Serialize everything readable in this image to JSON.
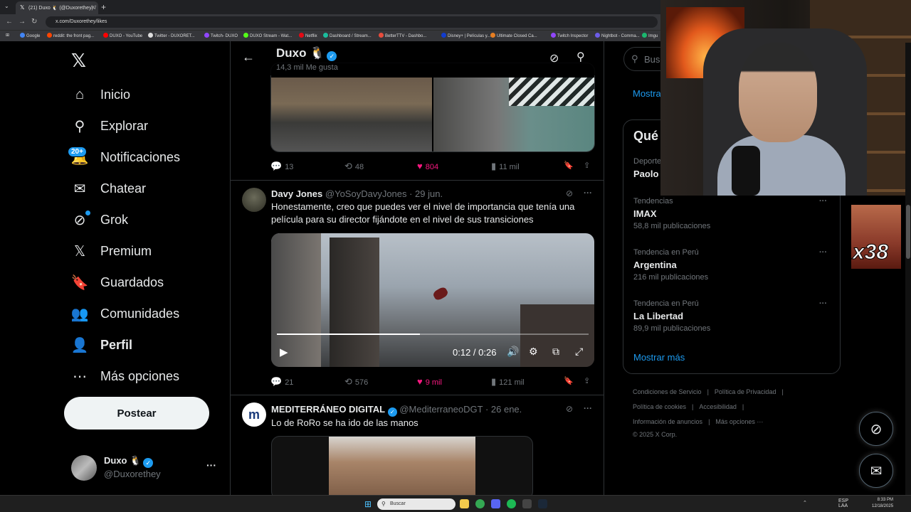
{
  "browser": {
    "tab_title": "(21) Duxo 🐧 (@Duxorethey) /",
    "url": "x.com/Duxorethey/likes",
    "bookmarks": [
      "Google",
      "reddit: the front pag...",
      "DUXO - YouTube",
      "Twitter - DUXORET...",
      "Twitch- DUXO",
      "DUXO Stream - Wat...",
      "Netflix",
      "Dashboard / Stream...",
      "BetterTTV - Dashbo...",
      "Disney+ | Películas y...",
      "Ultimate Closed Ca...",
      "Twitch Inspector",
      "Nightbot - Comma...",
      "Imgu"
    ],
    "bookmark_colors": [
      "#4285f4",
      "#ff4500",
      "#ff0000",
      "#dddddd",
      "#9146ff",
      "#53fc18",
      "#e50914",
      "#1abc9c",
      "#e74c3c",
      "#113ccf",
      "#e67e22",
      "#9146ff",
      "#6c5ce7",
      "#1bb76e"
    ]
  },
  "sidebar": {
    "logo": "𝕏",
    "notif_badge": "20+",
    "items": [
      {
        "label": "Inicio",
        "icon": "home-icon",
        "glyph": "⌂"
      },
      {
        "label": "Explorar",
        "icon": "search-icon",
        "glyph": "⚲"
      },
      {
        "label": "Notificaciones",
        "icon": "bell-icon",
        "glyph": "🔔"
      },
      {
        "label": "Chatear",
        "icon": "mail-icon",
        "glyph": "✉"
      },
      {
        "label": "Grok",
        "icon": "grok-icon",
        "glyph": "⊘"
      },
      {
        "label": "Premium",
        "icon": "x-icon",
        "glyph": "𝕏"
      },
      {
        "label": "Guardados",
        "icon": "bookmark-icon",
        "glyph": "🔖"
      },
      {
        "label": "Comunidades",
        "icon": "communities-icon",
        "glyph": "👥"
      },
      {
        "label": "Perfil",
        "icon": "profile-icon",
        "glyph": "👤"
      },
      {
        "label": "Más opciones",
        "icon": "more-circle-icon",
        "glyph": "⋯"
      }
    ],
    "post_button": "Postear",
    "account": {
      "name": "Duxo 🐧",
      "handle": "@Duxorethey",
      "more": "···"
    }
  },
  "main": {
    "header": {
      "name": "Duxo 🐧",
      "sub": "14,3 mil Me gusta"
    },
    "tweet0": {
      "replies": "13",
      "retweets": "48",
      "likes": "804",
      "views": "11 mil"
    },
    "tweet1": {
      "name": "Davy Jones",
      "meta": "@YoSoyDavyJones · 29 jun.",
      "text": "Honestamente, creo que puedes ver el nivel de importancia que tenía una película para su director fijándote en el nivel de sus transiciones",
      "video_time": "0:12 / 0:26",
      "video_progress": 0.46,
      "replies": "21",
      "retweets": "576",
      "likes": "9 mil",
      "views": "121 mil"
    },
    "tweet2": {
      "name": "MEDITERRÁNEO DIGITAL",
      "meta": "@MediterraneoDGT · 26 ene.",
      "text": "Lo de RoRo se ha ido de las manos"
    }
  },
  "right": {
    "search_placeholder": "Busc",
    "show_more_top": "Mostra",
    "panel_title": "Qué",
    "trends": [
      {
        "category": "Deporte",
        "name": "Paolo",
        "posts": ""
      },
      {
        "category": "Tendencias",
        "name": "IMAX",
        "posts": "58,8 mil publicaciones"
      },
      {
        "category": "Tendencia en Perú",
        "name": "Argentina",
        "posts": "216 mil publicaciones"
      },
      {
        "category": "Tendencia en Perú",
        "name": "La Libertad",
        "posts": "89,9 mil publicaciones"
      }
    ],
    "show_more": "Mostrar más",
    "footer": {
      "row1": [
        "Condiciones de Servicio",
        "|",
        "Política de Privacidad",
        "|"
      ],
      "row2": [
        "Política de cookies",
        "|",
        "Accesibilidad",
        "|"
      ],
      "row3": [
        "Información de anuncios",
        "|",
        "Más opciones ···"
      ],
      "copyright": "© 2025 X Corp."
    }
  },
  "overlay": {
    "sticker_text": "x38"
  },
  "taskbar": {
    "search": "Buscar",
    "lang": "ESP\nLAA",
    "time": "8:33 PM",
    "date": "12/18/2025"
  },
  "colors": {
    "accent": "#1d9bf0",
    "like": "#f91880",
    "bg": "#000000",
    "border": "#2f3336"
  }
}
